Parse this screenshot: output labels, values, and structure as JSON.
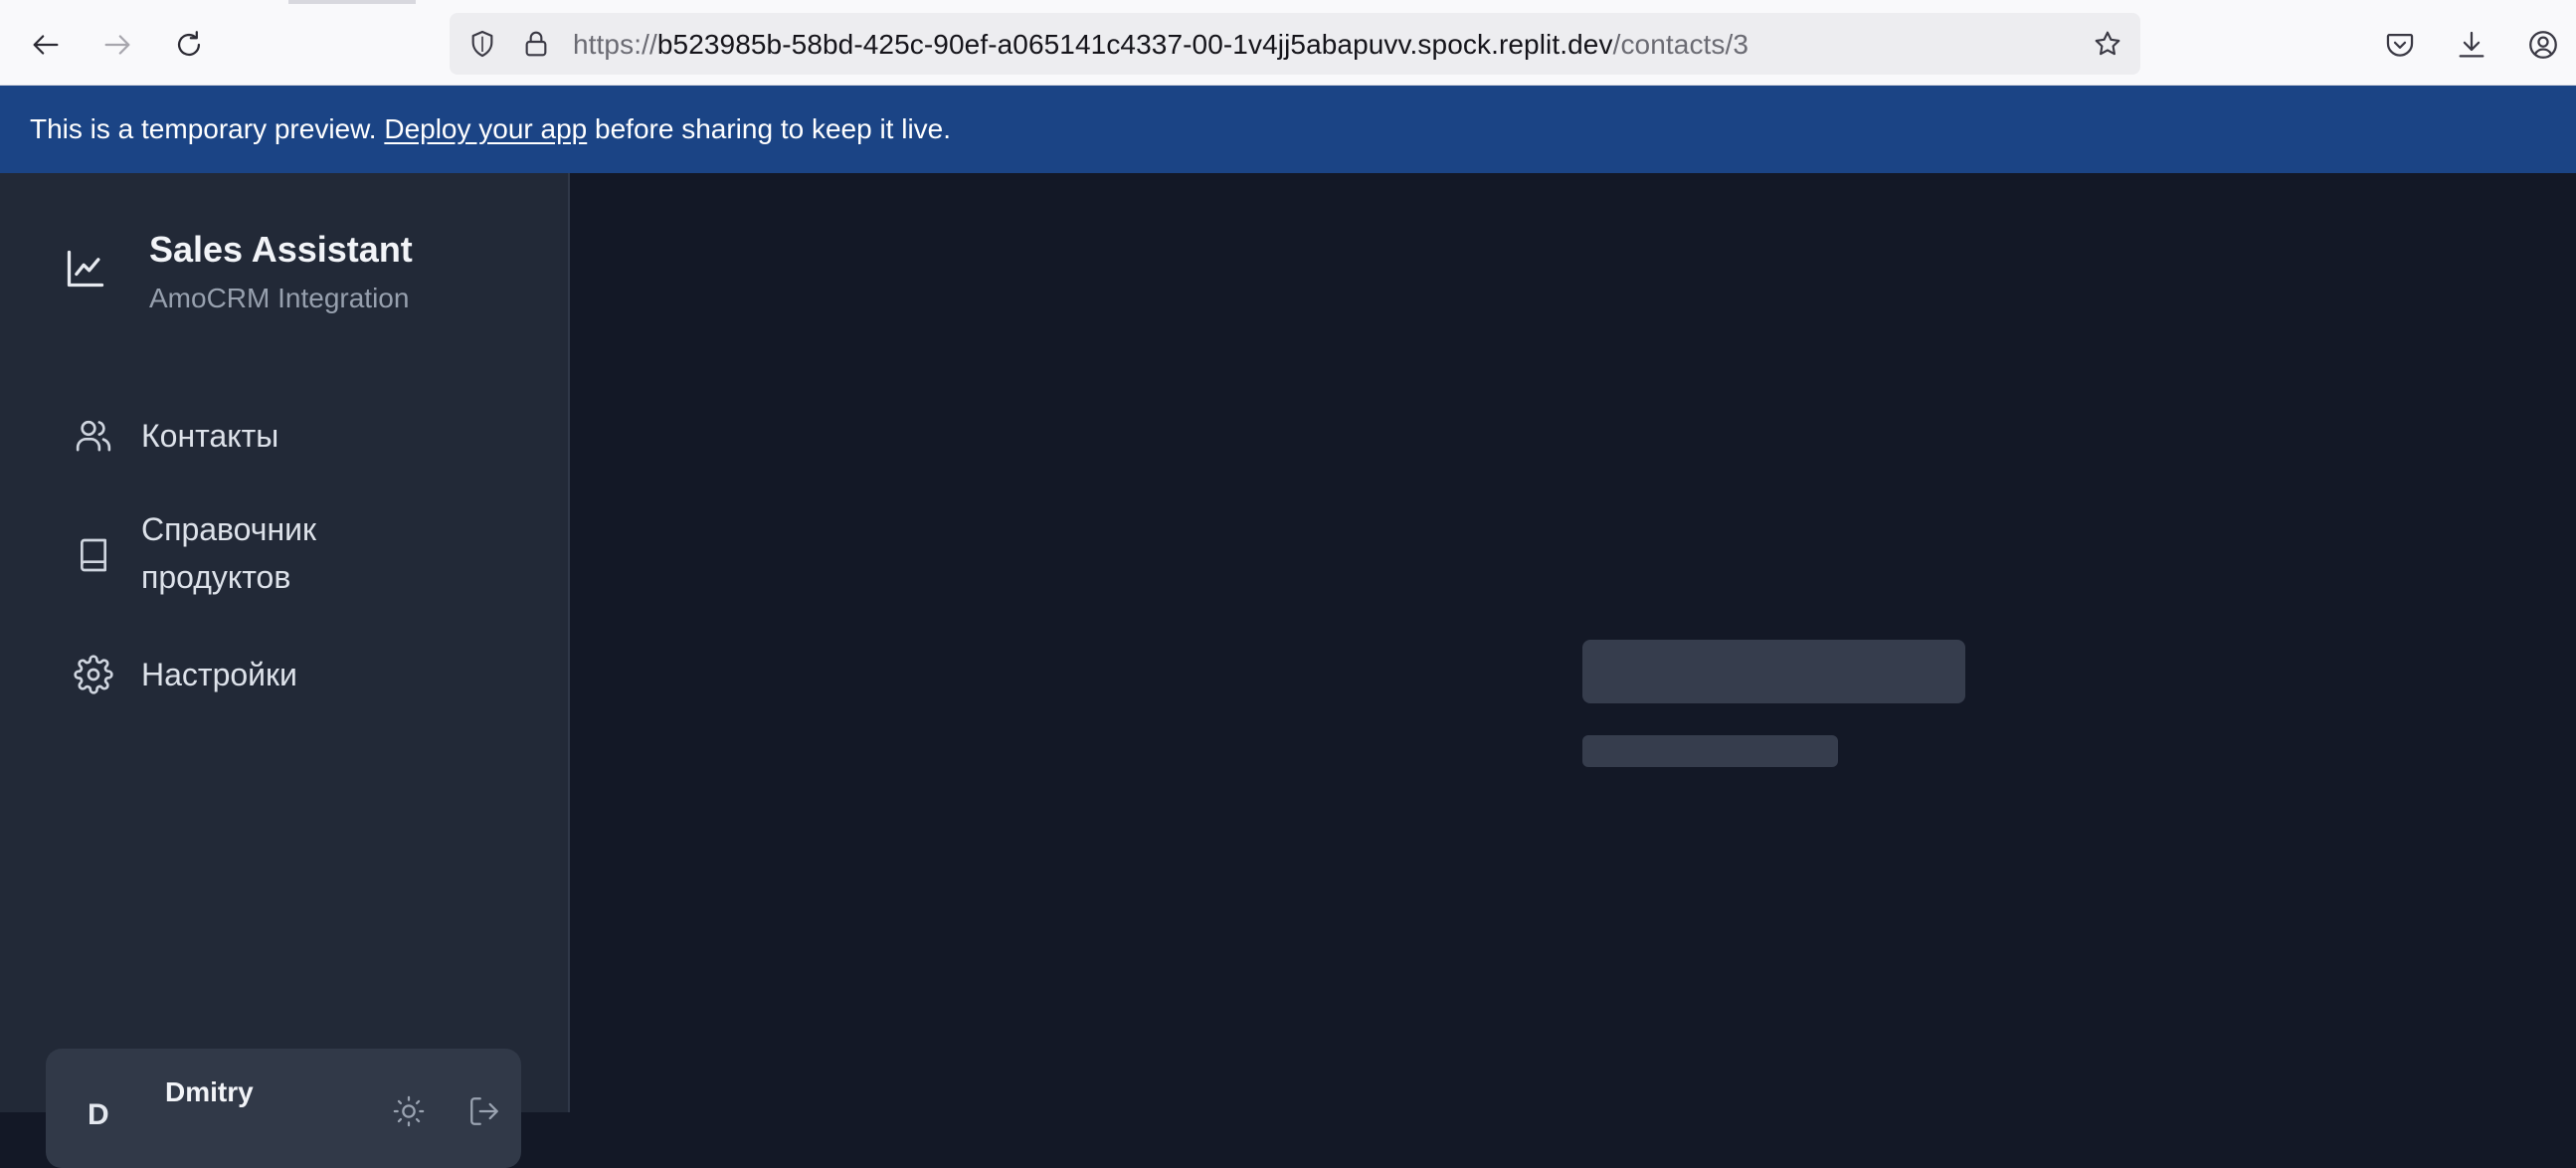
{
  "browser": {
    "url_prefix": "https://",
    "url_host": "b523985b-58bd-425c-90ef-a065141c4337-00-1v4jj5abapuvv.spock.replit.dev",
    "url_path": "/contacts/3",
    "icons": {
      "back": "back-arrow-icon",
      "forward": "forward-arrow-icon",
      "reload": "reload-icon",
      "tracking": "shield-icon",
      "secure": "lock-icon",
      "bookmark": "star-icon",
      "pocket": "pocket-icon",
      "downloads": "download-icon",
      "account": "account-icon"
    }
  },
  "banner": {
    "text_before": "This is a temporary preview. ",
    "link": "Deploy your app",
    "text_after": " before sharing to keep it live.",
    "color": "#1b4485"
  },
  "sidebar": {
    "title": "Sales Assistant",
    "subtitle": "AmoCRM Integration",
    "brand_icon": "line-chart-icon",
    "items": [
      {
        "label": "Контакты",
        "icon": "users-icon"
      },
      {
        "label": "Справочник продуктов",
        "icon": "book-icon"
      },
      {
        "label": "Настройки",
        "icon": "gear-icon"
      }
    ],
    "user": {
      "initial": "D",
      "name": "Dmitry",
      "theme_icon": "sun-icon",
      "logout_icon": "logout-icon"
    }
  },
  "main": {
    "state": "loading",
    "skeleton_color": "#363d4d"
  },
  "colors": {
    "background": "#131826",
    "sidebar": "#222937",
    "user_card": "#313948"
  }
}
